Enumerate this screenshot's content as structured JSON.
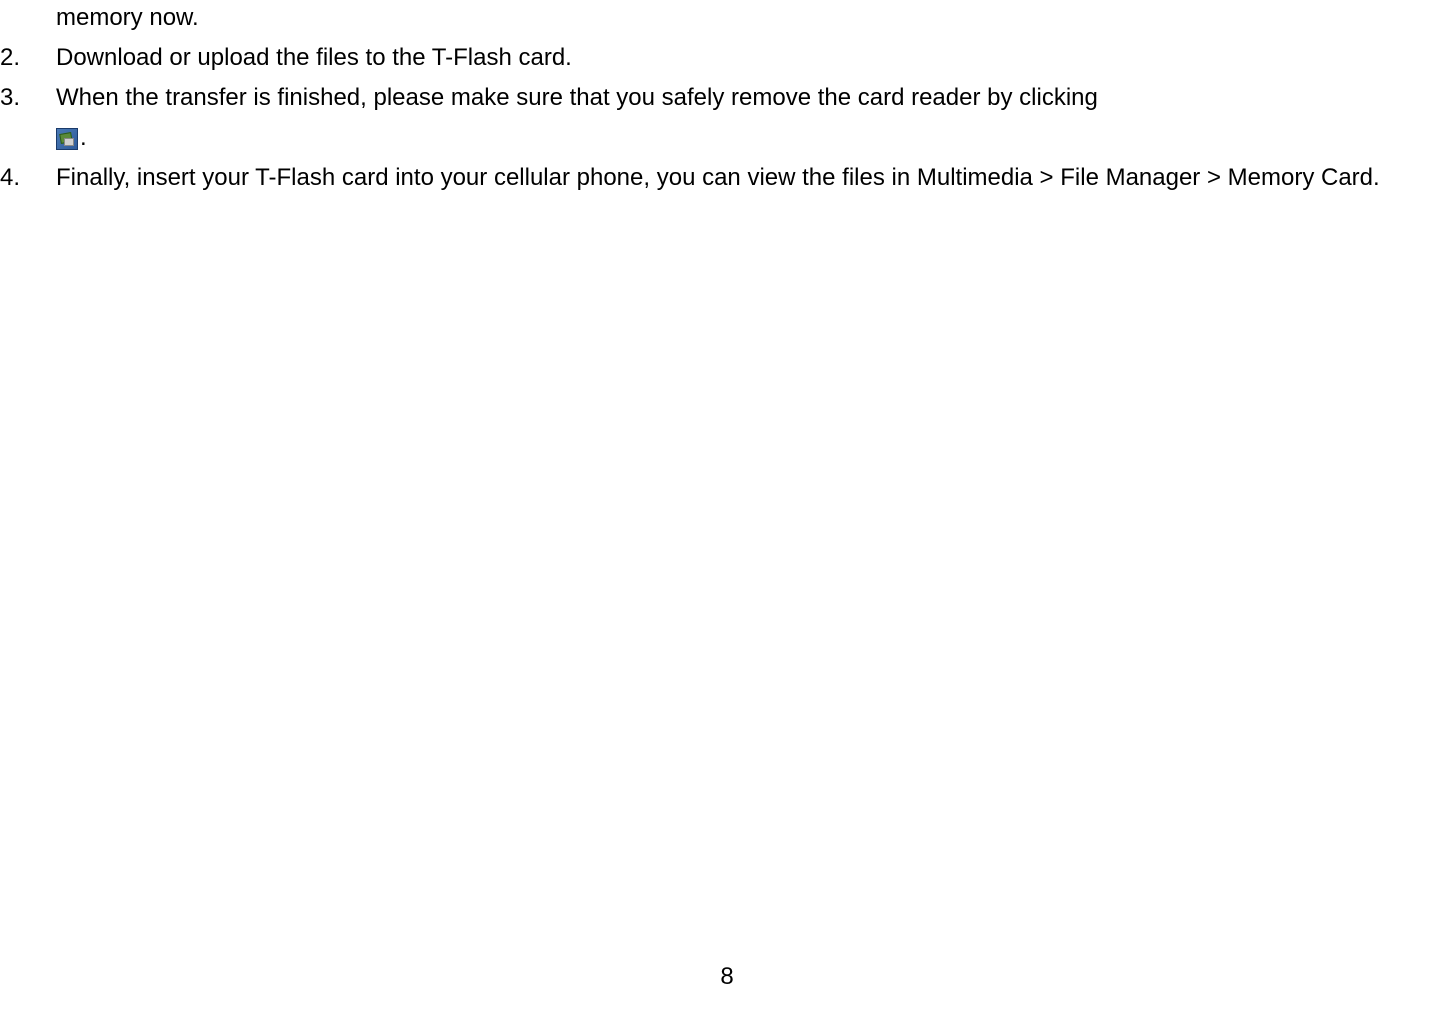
{
  "fragment_top": "memory now.",
  "items": [
    {
      "number": "2.",
      "text": "Download or upload the files to the T-Flash card."
    },
    {
      "number": "3.",
      "text": "When the transfer is finished, please make sure that you safely remove the card reader by clicking"
    },
    {
      "number": "4.",
      "text": "Finally, insert your T-Flash card into your cellular phone, you can view the files in Multimedia > File Manager > Memory Card."
    }
  ],
  "icon_trailing": ".",
  "page_number": "8"
}
